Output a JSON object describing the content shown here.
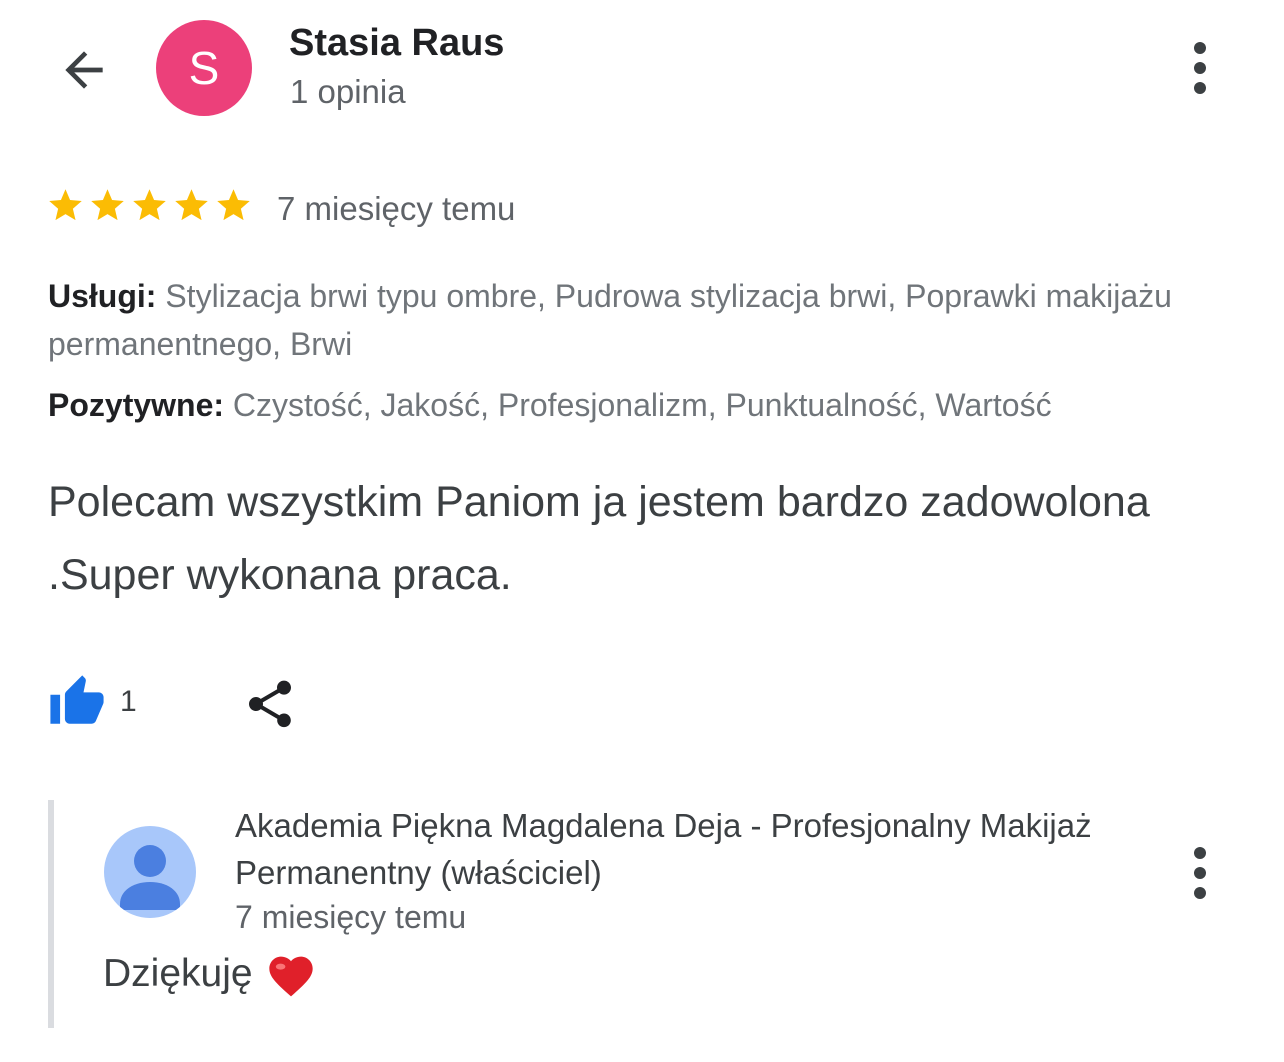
{
  "header": {
    "avatar_letter": "S",
    "avatar_color": "#ec407a",
    "author_name": "Stasia Raus",
    "review_count": "1 opinia",
    "back_icon": "arrow-left-icon",
    "menu_icon": "more-vert-icon"
  },
  "review": {
    "rating": 5,
    "rating_max": 5,
    "star_color": "#fbbc04",
    "time": "7 miesięcy temu",
    "services_label": "Usługi:",
    "services_value": "Stylizacja brwi typu ombre, Pudrowa stylizacja brwi, Poprawki makijażu permanentnego, Brwi",
    "positive_label": "Pozytywne:",
    "positive_value": "Czystość, Jakość, Profesjonalizm, Punktualność, Wartość",
    "text": "Polecam wszystkim Paniom ja jestem bardzo zadowolona .Super wykonana praca."
  },
  "actions": {
    "like_icon": "thumbs-up-icon",
    "like_color": "#1a73e8",
    "like_count": "1",
    "share_icon": "share-icon"
  },
  "owner_reply": {
    "avatar_icon": "person-icon",
    "name": "Akademia Piękna Magdalena Deja - Profesjonalny Makijaż Permanentny (właściciel)",
    "time": "7 miesięcy temu",
    "text": "Dziękuję",
    "emoji_icon": "red-heart-icon",
    "menu_icon": "more-vert-icon"
  }
}
